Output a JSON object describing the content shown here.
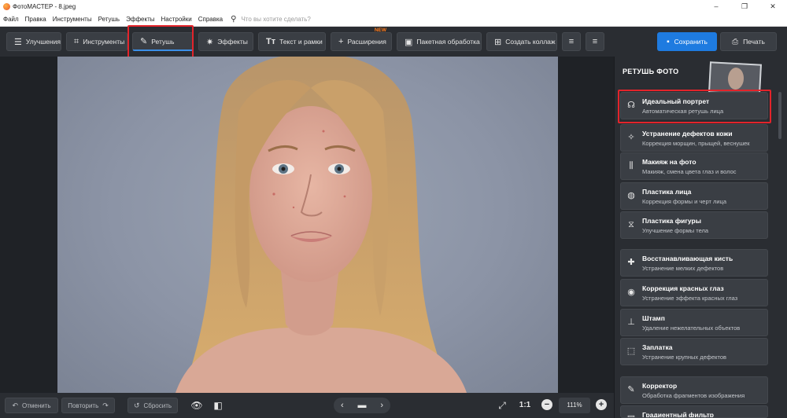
{
  "window": {
    "title": "ФотоМАСТЕР - 8.jpeg",
    "controls": {
      "minimize": "–",
      "maximize": "❐",
      "close": "✕"
    }
  },
  "menu": {
    "items": [
      "Файл",
      "Правка",
      "Инструменты",
      "Ретушь",
      "Эффекты",
      "Настройки",
      "Справка"
    ],
    "search_placeholder": "Что вы хотите сделать?"
  },
  "toolbar": {
    "tabs": [
      {
        "label": "Улучшения",
        "icon": "sliders-icon"
      },
      {
        "label": "Инструменты",
        "icon": "crop-icon"
      },
      {
        "label": "Ретушь",
        "icon": "brush-icon"
      },
      {
        "label": "Эффекты",
        "icon": "sparkle-icon"
      },
      {
        "label": "Текст и рамки",
        "icon": "text-icon"
      },
      {
        "label": "Расширения",
        "icon": "plus-icon",
        "badge": "NEW"
      },
      {
        "label": "Пакетная обработка",
        "icon": "images-icon"
      },
      {
        "label": "Создать коллаж",
        "icon": "collage-icon"
      }
    ],
    "active_tab": "Ретушь",
    "save_label": "Сохранить",
    "print_label": "Печать"
  },
  "panel": {
    "title": "РЕТУШЬ ФОТО",
    "tools": [
      {
        "title": "Идеальный портрет",
        "subtitle": "Автоматическая ретушь лица",
        "icon": "portrait-icon"
      },
      {
        "title": "Устранение дефектов кожи",
        "subtitle": "Коррекция морщин, прыщей, веснушек",
        "icon": "skin-icon"
      },
      {
        "title": "Макияж на фото",
        "subtitle": "Макияж, смена цвета глаз и волос",
        "icon": "makeup-icon"
      },
      {
        "title": "Пластика лица",
        "subtitle": "Коррекция формы и черт лица",
        "icon": "face-shape-icon"
      },
      {
        "title": "Пластика фигуры",
        "subtitle": "Улучшение формы тела",
        "icon": "body-shape-icon"
      },
      {
        "title": "Восстанавливающая кисть",
        "subtitle": "Устранение мелких дефектов",
        "icon": "bandage-icon"
      },
      {
        "title": "Коррекция красных глаз",
        "subtitle": "Устранение эффекта красных глаз",
        "icon": "eye-icon"
      },
      {
        "title": "Штамп",
        "subtitle": "Удаление нежелательных объектов",
        "icon": "stamp-icon"
      },
      {
        "title": "Заплатка",
        "subtitle": "Устранение крупных дефектов",
        "icon": "patch-icon"
      },
      {
        "title": "Корректор",
        "subtitle": "Обработка фрагментов изображения",
        "icon": "corrector-brush-icon"
      },
      {
        "title": "Градиентный фильтр",
        "subtitle": "",
        "icon": "gradient-icon"
      }
    ],
    "highlighted_tool": "Идеальный портрет"
  },
  "bottom": {
    "undo_label": "Отменить",
    "redo_label": "Повторить",
    "reset_label": "Сбросить",
    "zoom_one_to_one": "1:1",
    "zoom_value": "111%"
  }
}
